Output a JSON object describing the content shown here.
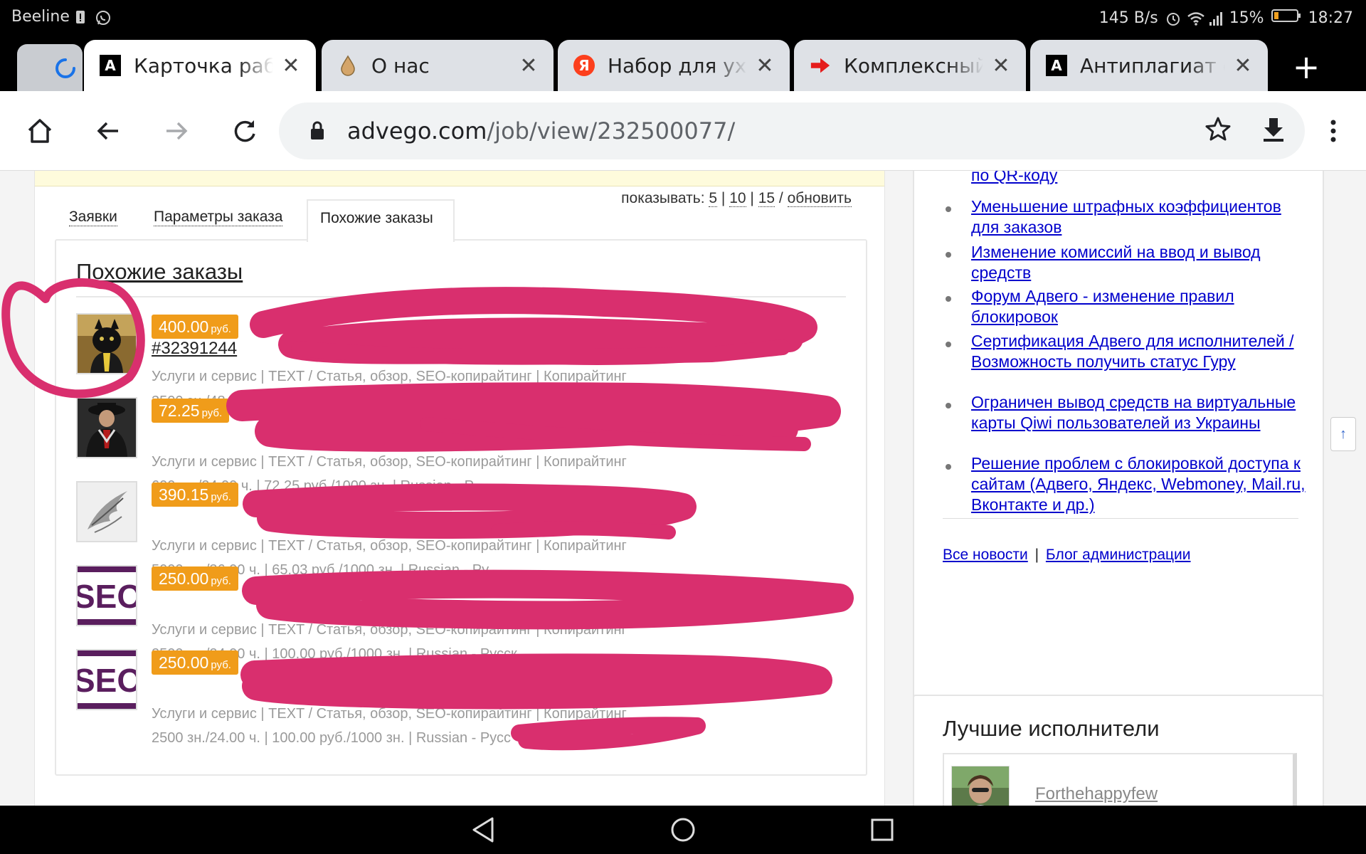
{
  "status": {
    "carrier": "Beeline",
    "speed": "145 B/s",
    "battery": "15%",
    "time": "18:27"
  },
  "tabs": [
    {
      "favicon": "A",
      "title": "Карточка работ",
      "active": true
    },
    {
      "favicon": "drop",
      "title": "О нас",
      "active": false
    },
    {
      "favicon": "Я",
      "title": "Набор для уход",
      "active": false
    },
    {
      "favicon": "arrow",
      "title": "Комплексный у",
      "active": false
    },
    {
      "favicon": "A",
      "title": "Антиплагиат он",
      "active": false
    }
  ],
  "toolbar": {
    "url_domain": "advego.com",
    "url_path": "/job/view/232500077/"
  },
  "job": {
    "show_label": "показывать:",
    "show_options": [
      "5",
      "10",
      "15"
    ],
    "refresh_label": "обновить",
    "tab_bids": "Заявки",
    "tab_params": "Параметры заказа",
    "tab_similar": "Похожие заказы",
    "section_title": "Похожие заказы",
    "orders": [
      {
        "price": "400.00",
        "currency": "руб.",
        "number": "#32391244",
        "category": "Услуги и сервис | TEXT / Статья, обзор, SEO-копирайтинг | Копирайтинг",
        "details": "3500 зн./48.00 ч. | 100.00 руб./1000 зн. | Russian - Русск"
      },
      {
        "price": "72.25",
        "currency": "руб.",
        "number": "",
        "category": "Услуги и сервис | TEXT / Статья, обзор, SEO-копирайтинг | Копирайтинг",
        "details": "600 зн./24.00 ч. | 72.25 руб./1000 зн. | Russian - Р"
      },
      {
        "price": "390.15",
        "currency": "руб.",
        "number": "",
        "category": "Услуги и сервис | TEXT / Статья, обзор, SEO-копирайтинг | Копирайтинг",
        "details": "5000 зн./36.00 ч. | 65.03 руб./1000 зн. | Russian - Ру"
      },
      {
        "price": "250.00",
        "currency": "руб.",
        "number": "",
        "category": "Услуги и сервис | TEXT / Статья, обзор, SEO-копирайтинг | Копирайтинг",
        "details": "2500 зн./24.00 ч. | 100.00 руб./1000 зн. | Russian - Русск"
      },
      {
        "price": "250.00",
        "currency": "руб.",
        "number": "",
        "category": "Услуги и сервис | TEXT / Статья, обзор, SEO-копирайтинг | Копирайтинг",
        "details": "2500 зн./24.00 ч. | 100.00 руб./1000 зн. | Russian - Русс"
      }
    ]
  },
  "news": {
    "items": [
      "по QR-коду",
      "Уменьшение штрафных коэффициентов для заказов",
      "Изменение комиссий на ввод и вывод средств",
      "Форум Адвего - изменение правил блокировок",
      "Сертификация Адвего для исполнителей / Возможность получить статус Гуру",
      "Ограничен вывод средств на виртуальные карты Qiwi пользователей из Украины",
      "Решение проблем с блокировкой доступа к сайтам (Адвего, Яндекс, Webmoney, Mail.ru, Вконтакте и др.)"
    ],
    "all_news": "Все новости",
    "separator": "|",
    "admin_blog": "Блог администрации"
  },
  "best": {
    "title": "Лучшие исполнители",
    "first_name": "Forthehappyfew"
  },
  "scroll_top_label": "↑",
  "colors": {
    "price_badge": "#f09c1a",
    "link": "#0000cc",
    "scribble": "#d92f6e"
  }
}
